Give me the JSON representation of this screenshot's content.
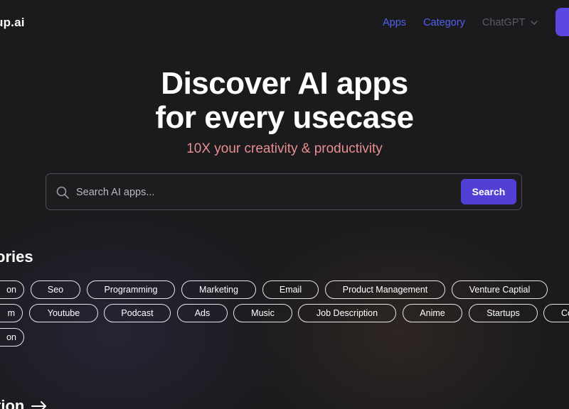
{
  "header": {
    "logo_text": "up.ai",
    "nav": {
      "apps": "Apps",
      "category": "Category",
      "chatgpt": "ChatGPT"
    }
  },
  "hero": {
    "title_line1": "Discover AI apps",
    "title_line2": "for every usecase",
    "subtitle": "10X your creativity & productivity"
  },
  "search": {
    "placeholder": "Search AI apps...",
    "button_label": "Search"
  },
  "categories": {
    "title": "ories",
    "row1": [
      "on",
      "Seo",
      "Programming",
      "Marketing",
      "Email",
      "Product Management",
      "Venture Captial"
    ],
    "row2": [
      "m",
      "Youtube",
      "Podcast",
      "Ads",
      "Music",
      "Job Description",
      "Anime",
      "Startups",
      "Co"
    ],
    "row3": [
      "on"
    ]
  },
  "next_section": {
    "title": "tion"
  },
  "colors": {
    "background": "#1b1a1c",
    "nav_link": "#4f63f0",
    "nav_muted": "#5b5b66",
    "accent": "#5240d6",
    "subtitle": "#e98f93"
  }
}
